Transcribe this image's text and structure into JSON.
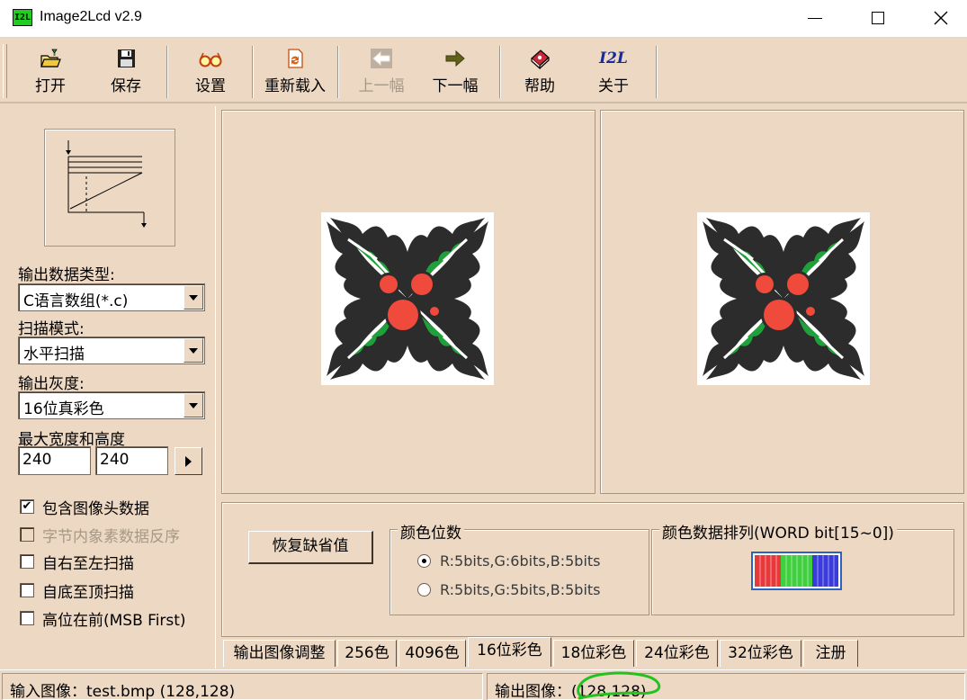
{
  "window": {
    "icon_text": "I2L",
    "title": "Image2Lcd v2.9"
  },
  "toolbar": {
    "buttons": [
      {
        "label": "打开",
        "icon": "open-folder-icon"
      },
      {
        "label": "保存",
        "icon": "floppy-disk-icon"
      },
      {
        "label": "设置",
        "icon": "glasses-icon"
      },
      {
        "label": "重新载入",
        "icon": "reload-icon"
      },
      {
        "label": "上一幅",
        "icon": "arrow-left-icon",
        "disabled": true
      },
      {
        "label": "下一幅",
        "icon": "arrow-right-icon"
      },
      {
        "label": "帮助",
        "icon": "help-book-icon"
      },
      {
        "label": "关于",
        "icon": "i2l-logo-icon",
        "icon_text": "I2L"
      }
    ]
  },
  "left": {
    "output_type_label": "输出数据类型:",
    "output_type_value": "C语言数组(*.c)",
    "scan_mode_label": "扫描模式:",
    "scan_mode_value": "水平扫描",
    "gray_label": "输出灰度:",
    "gray_value": "16位真彩色",
    "max_size_label": "最大宽度和高度",
    "max_width": "240",
    "max_height": "240",
    "options": [
      {
        "label": "包含图像头数据",
        "checked": true,
        "disabled": false
      },
      {
        "label": "字节内象素数据反序",
        "checked": false,
        "disabled": true
      },
      {
        "label": "自右至左扫描",
        "checked": false,
        "disabled": false
      },
      {
        "label": "自底至顶扫描",
        "checked": false,
        "disabled": false
      },
      {
        "label": "高位在前(MSB First)",
        "checked": false,
        "disabled": false
      }
    ]
  },
  "settings": {
    "restore_label": "恢复缺省值",
    "color_bits_title": "颜色位数",
    "color_bits_options": [
      {
        "label": "R:5bits,G:6bits,B:5bits",
        "selected": true
      },
      {
        "label": "R:5bits,G:5bits,B:5bits",
        "selected": false
      }
    ],
    "color_order_title": "颜色数据排列(WORD bit[15~0])",
    "colors": {
      "red": "#e8393a",
      "green": "#3fcf3f",
      "blue": "#3b3bdc"
    }
  },
  "tabs": [
    {
      "label": "输出图像调整",
      "active": false
    },
    {
      "label": "256色",
      "active": false
    },
    {
      "label": "4096色",
      "active": false
    },
    {
      "label": "16位彩色",
      "active": true
    },
    {
      "label": "18位彩色",
      "active": false
    },
    {
      "label": "24位彩色",
      "active": false
    },
    {
      "label": "32位彩色",
      "active": false
    },
    {
      "label": "注册",
      "active": false
    }
  ],
  "status": {
    "input": "输入图像：test.bmp (128,128)",
    "output": "输出图像：(128,128)"
  }
}
